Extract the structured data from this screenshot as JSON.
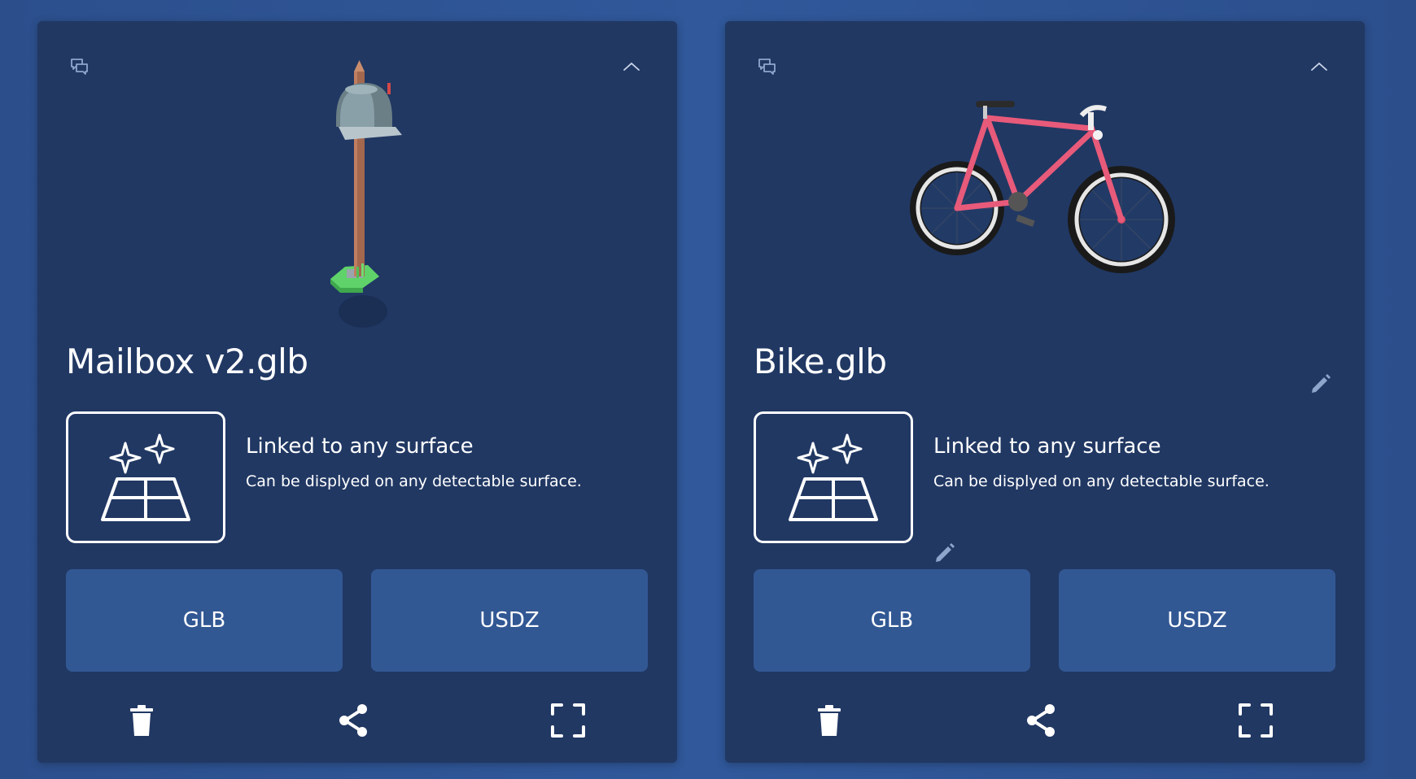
{
  "colors": {
    "background": "#2f5592",
    "card": "#213863",
    "button": "#325894",
    "text": "#ffffff",
    "icon_muted": "#8fa6cc"
  },
  "cards": [
    {
      "name": "Mailbox v2.glb",
      "model_icon": "mailbox-model",
      "placement": {
        "title": "Linked to any surface",
        "description": "Can be displyed on any detectable surface."
      },
      "buttons": {
        "glb": "GLB",
        "usdz": "USDZ"
      },
      "icons": {
        "comment": "comment-icon",
        "collapse": "chevron-up-icon",
        "placement": "surface-sparkle-icon",
        "delete": "trash-icon",
        "share": "share-icon",
        "fullscreen": "fullscreen-icon"
      }
    },
    {
      "name": "Bike.glb",
      "model_icon": "bike-model",
      "placement": {
        "title": "Linked to any surface",
        "description": "Can be displyed on any detectable surface."
      },
      "buttons": {
        "glb": "GLB",
        "usdz": "USDZ"
      },
      "icons": {
        "comment": "comment-icon",
        "collapse": "chevron-up-icon",
        "edit": "pencil-icon",
        "placement": "surface-sparkle-icon",
        "delete": "trash-icon",
        "share": "share-icon",
        "fullscreen": "fullscreen-icon"
      }
    }
  ]
}
